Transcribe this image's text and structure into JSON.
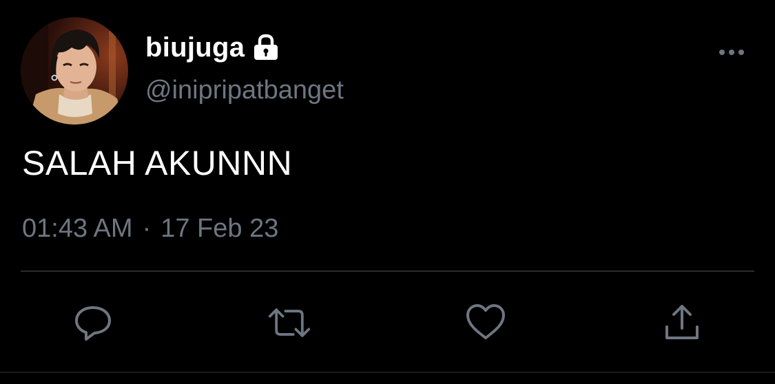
{
  "tweet": {
    "author": {
      "display_name": "biujuga",
      "handle": "@inipripatbanget",
      "protected_icon": "lock-icon",
      "avatar_icon": "user-avatar"
    },
    "text": "SALAH AKUNNN",
    "time": "01:43 AM",
    "separator": "·",
    "date": "17 Feb 23",
    "more_icon": "ellipsis-icon"
  },
  "actions": [
    {
      "name": "reply",
      "icon": "reply-icon"
    },
    {
      "name": "retweet",
      "icon": "retweet-icon"
    },
    {
      "name": "like",
      "icon": "heart-icon"
    },
    {
      "name": "share",
      "icon": "share-icon"
    }
  ],
  "colors": {
    "background": "#000000",
    "primary_text": "#ffffff",
    "secondary_text": "#6e7681",
    "divider": "#2a2d31"
  }
}
